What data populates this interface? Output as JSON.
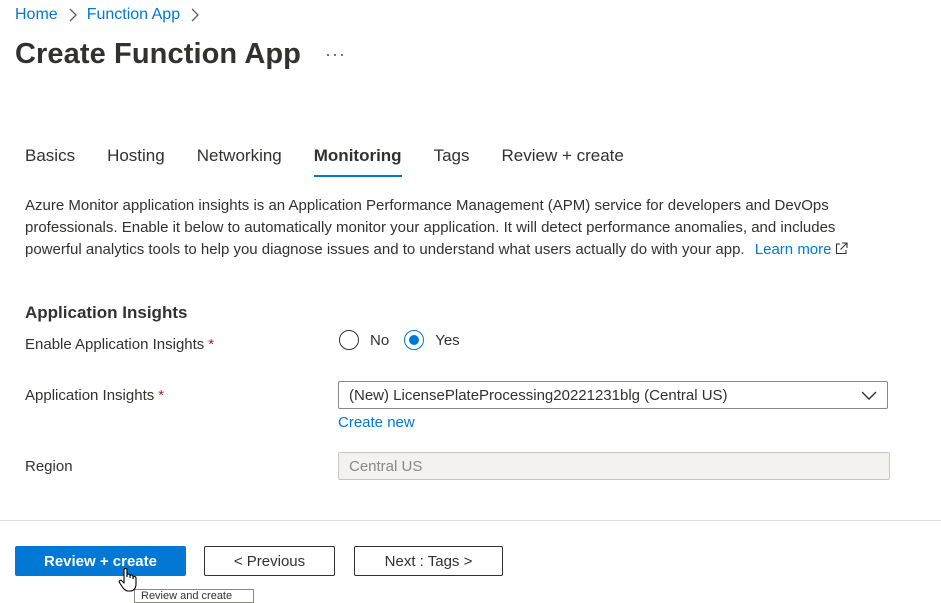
{
  "breadcrumb": {
    "items": [
      "Home",
      "Function App"
    ]
  },
  "page": {
    "title": "Create Function App",
    "more": "···"
  },
  "tabs": [
    {
      "label": "Basics"
    },
    {
      "label": "Hosting"
    },
    {
      "label": "Networking"
    },
    {
      "label": "Monitoring",
      "active": true
    },
    {
      "label": "Tags"
    },
    {
      "label": "Review + create"
    }
  ],
  "description": {
    "text": "Azure Monitor application insights is an Application Performance Management (APM) service for developers and DevOps professionals. Enable it below to automatically monitor your application. It will detect performance anomalies, and includes powerful analytics tools to help you diagnose issues and to understand what users actually do with your app.",
    "learn_more": "Learn more"
  },
  "section": {
    "title": "Application Insights"
  },
  "fields": {
    "enable_label": "Enable Application Insights",
    "required_mark": "*",
    "radio_no": "No",
    "radio_yes": "Yes",
    "selected": "Yes",
    "insights_label": "Application Insights",
    "insights_value": "(New) LicensePlateProcessing20221231blg (Central US)",
    "create_new": "Create new",
    "region_label": "Region",
    "region_value": "Central US"
  },
  "footer": {
    "review_create": "Review + create",
    "previous": "< Previous",
    "next": "Next : Tags >",
    "tooltip": "Review and create"
  },
  "colors": {
    "accent": "#0078d4",
    "required": "#a4262c",
    "text": "#323130"
  }
}
